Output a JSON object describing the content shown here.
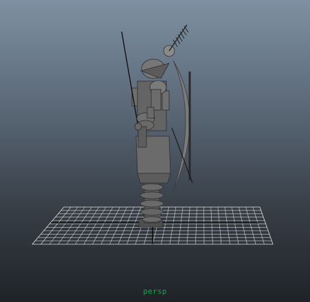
{
  "viewport": {
    "camera_label": "persp",
    "label_color": "#15a84a"
  }
}
